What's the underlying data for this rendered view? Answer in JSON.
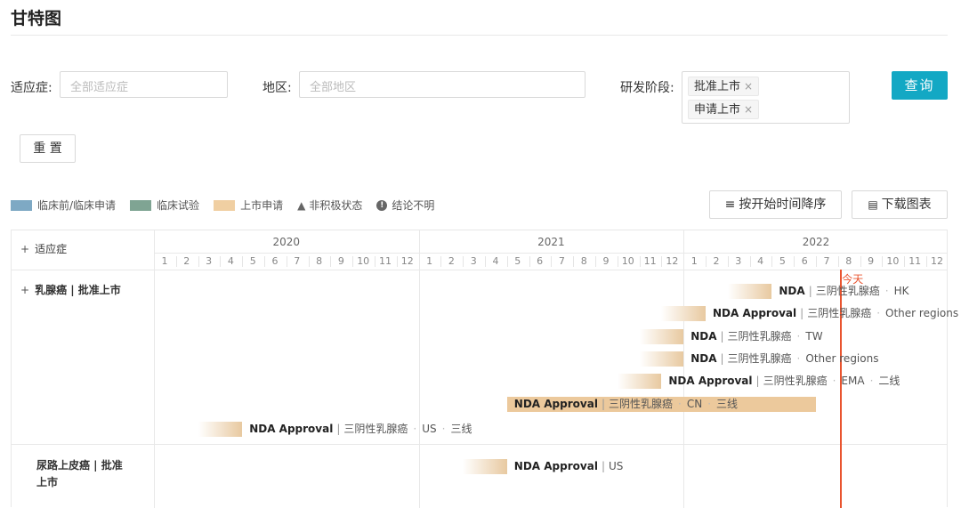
{
  "page": {
    "title": "甘特图"
  },
  "filters": {
    "indication": {
      "label": "适应症:",
      "placeholder": "全部适应症"
    },
    "region": {
      "label": "地区:",
      "placeholder": "全部地区"
    },
    "stage": {
      "label": "研发阶段:",
      "tags": [
        {
          "label": "批准上市",
          "remove": "×"
        },
        {
          "label": "申请上市",
          "remove": "×"
        }
      ]
    },
    "search_label": "查询",
    "reset_label": "重 置"
  },
  "legend": {
    "items": [
      {
        "label": "临床前/临床申请",
        "color": "#7ea9c4"
      },
      {
        "label": "临床试验",
        "color": "#7fa493"
      },
      {
        "label": "上市申请",
        "color": "#f0cfa2"
      }
    ],
    "inactive": {
      "icon": "▲",
      "label": "非积极状态"
    },
    "unclear": {
      "icon": "!",
      "label": "结论不明"
    }
  },
  "toolbar": {
    "sort_icon": "≡",
    "sort_label": "按开始时间降序",
    "download_icon": "▤",
    "download_label": "下载图表"
  },
  "gantt": {
    "header": {
      "column_label": "适应症",
      "expand": "+"
    },
    "years": [
      "2020",
      "2021",
      "2022"
    ],
    "months": [
      "1",
      "2",
      "3",
      "4",
      "5",
      "6",
      "7",
      "8",
      "9",
      "10",
      "11",
      "12"
    ],
    "today_label": "今天",
    "today_month": "2022-08",
    "groups": [
      {
        "label": "乳腺癌 | 批准上市",
        "expand": "+",
        "items": [
          {
            "start": "2022-03",
            "end": "2022-04",
            "style": "gradient",
            "name": "NDA",
            "parts": [
              "三阴性乳腺癌",
              "HK"
            ]
          },
          {
            "start": "2021-12",
            "end": "2022-01",
            "style": "gradient",
            "name": "NDA Approval",
            "parts": [
              "三阴性乳腺癌",
              "Other regions"
            ]
          },
          {
            "start": "2021-11",
            "end": "2021-12",
            "style": "gradient",
            "name": "NDA",
            "parts": [
              "三阴性乳腺癌",
              "TW"
            ]
          },
          {
            "start": "2021-11",
            "end": "2021-12",
            "style": "gradient",
            "name": "NDA",
            "parts": [
              "三阴性乳腺癌",
              "Other regions"
            ]
          },
          {
            "start": "2021-10",
            "end": "2021-11",
            "style": "gradient",
            "name": "NDA Approval",
            "parts": [
              "三阴性乳腺癌",
              "EMA",
              "二线"
            ]
          },
          {
            "start": "2020-17",
            "end": "2022-06",
            "style": "solid",
            "name": "NDA Approval",
            "parts": [
              "三阴性乳腺癌",
              "CN",
              "三线"
            ]
          },
          {
            "start": "2020-03",
            "end": "2020-04",
            "style": "gradient",
            "name": "NDA Approval",
            "parts": [
              "三阴性乳腺癌",
              "US",
              "三线"
            ]
          }
        ]
      },
      {
        "label": "尿路上皮癌 | 批准上市",
        "items": [
          {
            "start": "2021-03",
            "end": "2021-04",
            "style": "gradient",
            "name": "NDA Approval",
            "parts": [
              "US"
            ]
          }
        ]
      }
    ]
  }
}
